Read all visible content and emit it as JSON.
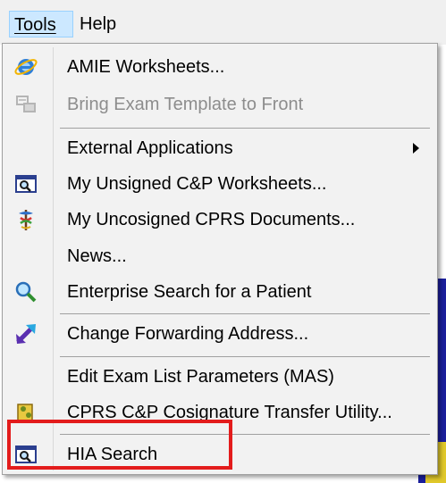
{
  "menubar": {
    "tools_label": "Tools",
    "help_label": "Help"
  },
  "menu": {
    "items": [
      {
        "label": "AMIE Worksheets...",
        "icon": "ie-globe-icon"
      },
      {
        "label": "Bring Exam Template to Front",
        "icon": "template-icon",
        "disabled": true
      },
      {
        "label": "External Applications",
        "icon": "none",
        "submenu": true
      },
      {
        "label": "My Unsigned C&P Worksheets...",
        "icon": "worksheet-magnifier-icon"
      },
      {
        "label": "My Uncosigned CPRS Documents...",
        "icon": "caduceus-icon"
      },
      {
        "label": "News...",
        "icon": "none"
      },
      {
        "label": "Enterprise Search for a Patient",
        "icon": "magnifier-icon"
      },
      {
        "label": "Change Forwarding Address...",
        "icon": "forward-arrow-icon"
      },
      {
        "label": "Edit Exam List Parameters (MAS)",
        "icon": "none"
      },
      {
        "label": "CPRS C&P Cosignature Transfer Utility...",
        "icon": "transfer-utility-icon"
      },
      {
        "label": "HIA Search",
        "icon": "worksheet-magnifier-icon"
      }
    ]
  },
  "colors": {
    "highlight_border": "#e31c1c",
    "menu_bg": "#f2f2f2",
    "active_menu_bg": "#cce8ff"
  }
}
